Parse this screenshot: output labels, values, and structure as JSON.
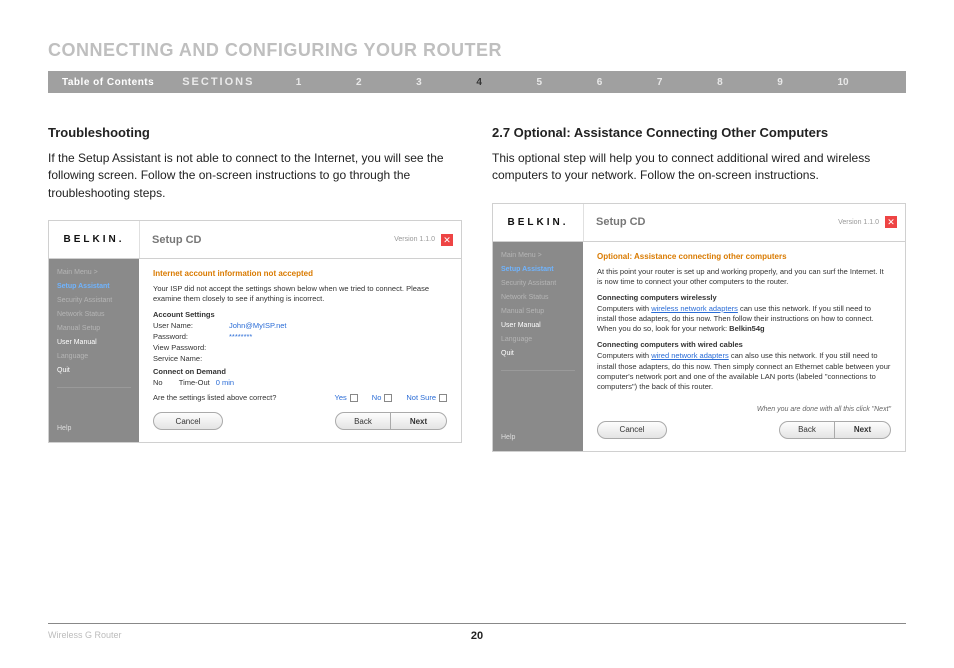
{
  "header": {
    "title": "CONNECTING AND CONFIGURING YOUR ROUTER",
    "toc": "Table of Contents",
    "sections_label": "SECTIONS",
    "sections": [
      "1",
      "2",
      "3",
      "4",
      "5",
      "6",
      "7",
      "8",
      "9",
      "10"
    ],
    "active_section": "4"
  },
  "left": {
    "heading": "Troubleshooting",
    "body": "If the Setup Assistant is not able to connect to the Internet, you will see the following screen. Follow the on-screen instructions to go through the troubleshooting steps.",
    "panel": {
      "logo": "BELKIN.",
      "title": "Setup CD",
      "version": "Version 1.1.0",
      "close": "✕",
      "sidebar": {
        "items": [
          {
            "label": "Main Menu  >",
            "cls": ""
          },
          {
            "label": "Setup Assistant",
            "cls": "active"
          },
          {
            "label": "Security Assistant",
            "cls": ""
          },
          {
            "label": "Network Status",
            "cls": ""
          },
          {
            "label": "Manual Setup",
            "cls": ""
          },
          {
            "label": "User Manual",
            "cls": "white"
          },
          {
            "label": "Language",
            "cls": ""
          },
          {
            "label": "Quit",
            "cls": "white"
          }
        ],
        "help": "Help"
      },
      "content": {
        "warn": "Internet account information not accepted",
        "intro": "Your ISP did not accept the settings shown below when we tried to connect. Please examine them closely to see if anything is incorrect.",
        "account_head": "Account Settings",
        "user_label": "User Name:",
        "user_value": "John@MyISP.net",
        "pass_label": "Password:",
        "pass_value": "********",
        "view_pass": "View Password:",
        "service_label": "Service Name:",
        "cod_head": "Connect on Demand",
        "cod_no": "No",
        "cod_timeout_label": "Time-Out",
        "cod_timeout_value": "0 min",
        "question": "Are the settings listed above correct?",
        "opt_yes": "Yes",
        "opt_no": "No",
        "opt_notsure": "Not Sure",
        "btn_cancel": "Cancel",
        "btn_back": "Back",
        "btn_next": "Next"
      }
    }
  },
  "right": {
    "heading": "2.7 Optional: Assistance Connecting Other Computers",
    "body": "This optional step will help you to connect additional wired and wireless computers to your network. Follow the on-screen instructions.",
    "panel": {
      "logo": "BELKIN.",
      "title": "Setup CD",
      "version": "Version 1.1.0",
      "close": "✕",
      "sidebar": {
        "items": [
          {
            "label": "Main Menu  >",
            "cls": ""
          },
          {
            "label": "Setup Assistant",
            "cls": "active"
          },
          {
            "label": "Security Assistant",
            "cls": ""
          },
          {
            "label": "Network Status",
            "cls": ""
          },
          {
            "label": "Manual Setup",
            "cls": ""
          },
          {
            "label": "User Manual",
            "cls": "white"
          },
          {
            "label": "Language",
            "cls": ""
          },
          {
            "label": "Quit",
            "cls": "white"
          }
        ],
        "help": "Help"
      },
      "content": {
        "warn": "Optional: Assistance connecting other computers",
        "intro": "At this point your router is set up and working properly, and you can surf the Internet. It is now time to connect your other computers to the router.",
        "wireless_head": "Connecting computers wirelessly",
        "wireless_pre": "Computers with ",
        "wireless_link": "wireless network adapters",
        "wireless_post": " can use this network. If you still need to install those adapters, do this now. Then follow their instructions on how to connect. When you do so, look for your network: ",
        "network_name": "Belkin54g",
        "wired_head": "Connecting computers with wired cables",
        "wired_pre": "Computers with ",
        "wired_link": "wired network adapters",
        "wired_post": " can also use this network. If you still need to install those adapters, do this now. Then simply connect an Ethernet cable between your computer's network port and one of the available LAN ports (labeled \"connections to computers\") the back of this router.",
        "done_note": "When you are done with all this click \"Next\"",
        "btn_cancel": "Cancel",
        "btn_back": "Back",
        "btn_next": "Next"
      }
    }
  },
  "footer": {
    "product": "Wireless G Router",
    "page": "20"
  }
}
